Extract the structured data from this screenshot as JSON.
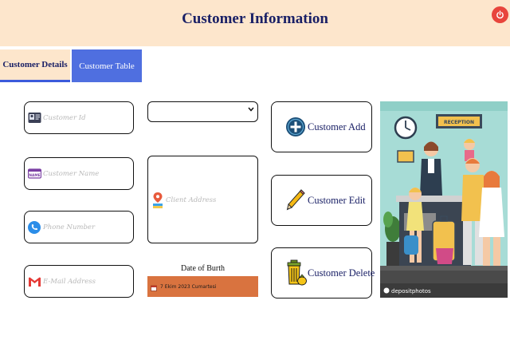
{
  "window": {
    "title": "Customer Information"
  },
  "tabs": [
    {
      "label": "Customer Details",
      "active": true
    },
    {
      "label": "Customer Table",
      "active": false
    }
  ],
  "fields": {
    "customer_id": {
      "placeholder": "Customer Id",
      "icon": "id-card-icon"
    },
    "customer_name": {
      "placeholder": "Customer Name",
      "icon": "name-tag-icon"
    },
    "phone_number": {
      "placeholder": "Phone Number",
      "icon": "phone-icon"
    },
    "email_address": {
      "placeholder": "E-Mail Address",
      "icon": "gmail-icon"
    },
    "client_address": {
      "placeholder": "Client Address",
      "icon": "map-pin-icon"
    },
    "dropdown": {
      "value": ""
    }
  },
  "date_of_birth": {
    "label": "Date of Burth",
    "value": "7 Ekim 2023 Cumartesi",
    "color": "#d9733f"
  },
  "buttons": {
    "add": {
      "label": "Customer Add",
      "icon": "plus-circle-icon"
    },
    "edit": {
      "label": "Customer Edit",
      "icon": "pencil-icon"
    },
    "delete": {
      "label": "Customer Delete",
      "icon": "trash-icon"
    }
  },
  "illustration": {
    "sign_text": "RECEPTION",
    "watermark": "depositphotos"
  },
  "colors": {
    "header_bg": "#fde6cc",
    "title": "#1a2066",
    "tab_active_bg": "#4f6fe0",
    "power": "#e8453c"
  }
}
